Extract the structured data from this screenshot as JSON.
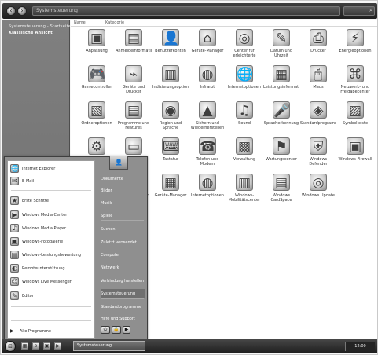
{
  "window": {
    "address": "Systemsteuerung",
    "header_items": [
      "Name",
      "Kategorie"
    ],
    "search_icon": "search-icon"
  },
  "left_pane": {
    "items": [
      "Systemsteuerung - Startseite",
      "Klassische Ansicht"
    ]
  },
  "icons": [
    {
      "label": "Anpassung",
      "symbol": "▣",
      "icon": "personalization-icon"
    },
    {
      "label": "Anmeldeinformationen",
      "symbol": "▤",
      "icon": "credentials-icon"
    },
    {
      "label": "Benutzerkonten",
      "symbol": "👤",
      "icon": "user-accounts-icon"
    },
    {
      "label": "Geräte-Manager",
      "symbol": "⌂",
      "icon": "device-manager-icon"
    },
    {
      "label": "Center für erleichterte Bedienung",
      "symbol": "◎",
      "icon": "ease-access-icon"
    },
    {
      "label": "Datum und Uhrzeit",
      "symbol": "✎",
      "icon": "date-time-icon"
    },
    {
      "label": "Drucker",
      "symbol": "⎙",
      "icon": "printer-icon"
    },
    {
      "label": "Energieoptionen",
      "symbol": "⚡",
      "icon": "power-options-icon"
    },
    {
      "label": "Gamecontroller",
      "symbol": "🎮",
      "icon": "gamecontroller-icon"
    },
    {
      "label": "Geräte und Drucker",
      "symbol": "⌁",
      "icon": "devices-printers-icon"
    },
    {
      "label": "Indizierungsoptionen",
      "symbol": "▥",
      "icon": "indexing-options-icon"
    },
    {
      "label": "Infrarot",
      "symbol": "◍",
      "icon": "infrared-icon"
    },
    {
      "label": "Internetoptionen",
      "symbol": "🌐",
      "icon": "internet-options-icon"
    },
    {
      "label": "Leistungsinformationen",
      "symbol": "▦",
      "icon": "performance-icon"
    },
    {
      "label": "Maus",
      "symbol": "🖱",
      "icon": "mouse-icon"
    },
    {
      "label": "Netzwerk- und Freigabecenter",
      "symbol": "⌘",
      "icon": "network-icon"
    },
    {
      "label": "Ordneroptionen",
      "symbol": "▧",
      "icon": "folder-options-icon"
    },
    {
      "label": "Programme und Features",
      "symbol": "▤",
      "icon": "programs-icon"
    },
    {
      "label": "Region und Sprache",
      "symbol": "◉",
      "icon": "region-language-icon"
    },
    {
      "label": "Sichern und Wiederherstellen",
      "symbol": "▲",
      "icon": "backup-icon"
    },
    {
      "label": "Sound",
      "symbol": "♫",
      "icon": "sound-icon"
    },
    {
      "label": "Spracherkennung",
      "symbol": "🎤",
      "icon": "speech-icon"
    },
    {
      "label": "Standardprogramme",
      "symbol": "◈",
      "icon": "default-programs-icon"
    },
    {
      "label": "Symbolleiste",
      "symbol": "▨",
      "icon": "toolbar-icon"
    },
    {
      "label": "System",
      "symbol": "⚙",
      "icon": "system-icon"
    },
    {
      "label": "Taskleiste",
      "symbol": "▭",
      "icon": "taskbar-icon"
    },
    {
      "label": "Tastatur",
      "symbol": "⌨",
      "icon": "keyboard-icon"
    },
    {
      "label": "Telefon und Modem",
      "symbol": "☎",
      "icon": "phone-modem-icon"
    },
    {
      "label": "Verwaltung",
      "symbol": "▩",
      "icon": "administrative-tools-icon"
    },
    {
      "label": "Wartungscenter",
      "symbol": "⚑",
      "icon": "action-center-icon"
    },
    {
      "label": "Windows Defender",
      "symbol": "⛨",
      "icon": "defender-icon"
    },
    {
      "label": "Windows-Firewall",
      "symbol": "▣",
      "icon": "firewall-icon"
    },
    {
      "label": "Windows Update",
      "symbol": "⟳",
      "icon": "windows-update-icon"
    },
    {
      "label": "Benutzerkonten",
      "symbol": "◐",
      "icon": "user-accounts-2-icon"
    },
    {
      "label": "Geräte-Manager",
      "symbol": "▦",
      "icon": "device-manager-2-icon"
    },
    {
      "label": "Internetoptionen",
      "symbol": "◍",
      "icon": "internet-options-2-icon"
    },
    {
      "label": "Windows-Mobilitätscenter",
      "symbol": "▥",
      "icon": "mobility-center-icon"
    },
    {
      "label": "Windows CardSpace",
      "symbol": "▤",
      "icon": "cardspace-icon"
    },
    {
      "label": "Windows Update",
      "symbol": "◎",
      "icon": "update-2-icon"
    }
  ],
  "start_menu": {
    "left_items": [
      {
        "label": "Internet Explorer",
        "symbol": "🌐",
        "icon": "internet-explorer-icon"
      },
      {
        "label": "E-Mail",
        "symbol": "✉",
        "icon": "email-icon"
      },
      {
        "label": "Erste Schritte",
        "symbol": "★",
        "icon": "getting-started-icon"
      },
      {
        "label": "Windows Media Center",
        "symbol": "▶",
        "icon": "media-center-icon"
      },
      {
        "label": "Windows Media Player",
        "symbol": "♪",
        "icon": "media-player-icon"
      },
      {
        "label": "Windows-Fotogalerie",
        "symbol": "▣",
        "icon": "photo-gallery-icon"
      },
      {
        "label": "Windows-Leistungsbewertung",
        "symbol": "▤",
        "icon": "experience-index-icon"
      },
      {
        "label": "Remoteunterstützung",
        "symbol": "◐",
        "icon": "remote-assistance-icon"
      },
      {
        "label": "Windows Live Messenger",
        "symbol": "☺",
        "icon": "messenger-icon"
      },
      {
        "label": "Editor",
        "symbol": "✎",
        "icon": "notepad-icon"
      }
    ],
    "all_programs": "Alle Programme",
    "right_items": [
      "Dokumente",
      "Bilder",
      "Musik",
      "Spiele",
      "Suchen",
      "Zuletzt verwendet",
      "Computer",
      "Netzwerk",
      "Verbindung herstellen",
      "Systemsteuerung",
      "Standardprogramme",
      "Hilfe und Support"
    ]
  },
  "taskbar": {
    "window_label": "Systemsteuerung",
    "time": "12:00"
  }
}
